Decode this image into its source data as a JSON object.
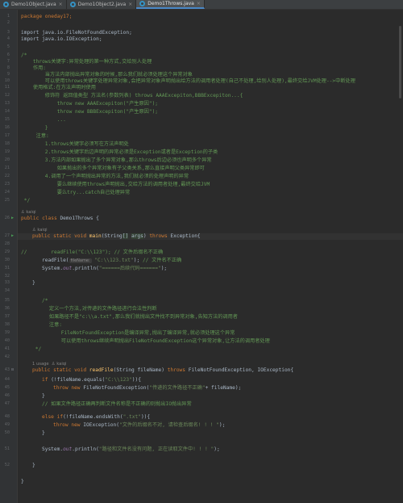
{
  "tabs": [
    {
      "label": "Demo1Object.java",
      "active": false
    },
    {
      "label": "Demo1Object2.java",
      "active": false
    },
    {
      "label": "Demo1Throws.java",
      "active": true
    }
  ],
  "gutter": {
    "numbers": [
      "1",
      "2",
      "3",
      "4",
      "5",
      "6",
      "7",
      "8",
      "9",
      "10",
      "11",
      "12",
      "13",
      "14",
      "15",
      "16",
      "17",
      "18",
      "19",
      "20",
      "21",
      "22",
      "23",
      "24",
      "25",
      "26",
      "27",
      "28",
      "29",
      "30",
      "31",
      "32",
      "33",
      "34",
      "35",
      "36",
      "37",
      "38",
      "39",
      "40",
      "41",
      "42",
      "43",
      "44",
      "45",
      "46",
      "47",
      "48",
      "49",
      "50",
      "51",
      "52"
    ],
    "run_icon": "run-icon"
  },
  "code": {
    "package_line": "package oneday17;",
    "import1": "import java.io.FileNotFoundException;",
    "import2": "import java.io.IOException;",
    "doc_open": "/*",
    "doc_l1": "    throws关键字:异常处理的第一种方式,交给别人处理",
    "doc_l2": "    作用:",
    "doc_l3": "        当方法内部抛出异常对象的时候,那么我们就必须处理这个异常对象",
    "doc_l4": "        可以使用throws关键字处理异常对象,会把异常对象声明抛出给方法的调用者处理(自己不处理,给别人处理),最终交给JVM处理-->中断处理",
    "doc_l5": "    使用格式:在方法声明时使用",
    "doc_l6": "        修饰符 返回值类型 方法名(参数列表) throws AAAExcepiton,BBBExcepiton...{",
    "doc_l7": "            throw new AAAExcepiton(\"产生原因\");",
    "doc_l8": "            throw new BBBExcepiton(\"产生原因\");",
    "doc_l9": "            ...",
    "doc_l10": "        }",
    "doc_l11": "     注意:",
    "doc_l12": "        1.throws关键字必须写在方法声明处",
    "doc_l13": "        2.throws关键字后边声明的异常必须是Exception或者是Exception的子类",
    "doc_l14": "        3.方法内部如果抛出了多个异常对象,那么throws后边必须也声明多个异常",
    "doc_l15": "            如果抛出的多个异常对象有子父类关系,那么直接声明父类异常即可",
    "doc_l16": "        4.调用了一个声明抛出异常的方法,我们就必须的处理声明的异常",
    "doc_l17": "            要么继续使用throws声明抛出,交给方法的调用者处理,最终交给JVM",
    "doc_l18": "            要么try...catch自己处理异常",
    "doc_close": " */",
    "author1": "kaiqi",
    "class_decl": "public class Demo1Throws {",
    "author2": "kaiqi",
    "main_decl_pre": "public static void main(String",
    "main_decl_arr": "[]",
    "main_decl_args": "args",
    "main_decl_post": ") throws Exception{",
    "l_comment_call": "//        readFile(\"C:\\\\123\"); // 文件后缀名不正确",
    "l_call_pre": "readFile(",
    "l_call_hint": "fileName:",
    "l_call_arg": "\"C:\\\\123.txt\"",
    "l_call_post": "); // 文件名不正确",
    "l_print1": "System.out.println(\"======后续代码======\");",
    "close_brace_main": "}",
    "doc2_open": "/*",
    "doc2_l1": "    定义一个方法,对传递的文件路径进行合法性判断",
    "doc2_l2": "    如果路径不是\"c:\\\\a.txt\",那么我们就抛出文件找不到异常对象,告知方法的调用者",
    "doc2_l3": "    注意:",
    "doc2_l4": "        FileNotFoundException是编译异常,抛出了编译异常,就必须处理这个异常",
    "doc2_l5": "        可以使用throws继续声明抛出FileNotFoundException这个异常对象,让方法的调用者处理",
    "doc2_close": " */",
    "usage": "1 usage",
    "author3": "kaiqi",
    "readfile_decl": "public static void readFile(String fileName) throws FileNotFoundException, IOException{",
    "if1": "if (!fileName.equals(\"C:\\\\123\")){",
    "throw1": "throw new FileNotFoundException(\"传递的文件路径不正确\"+ fileName);",
    "close1": "}",
    "comment_ext": "// 如果文件路径正确再判断文件名称是不正确的则抛出IO抛出异常",
    "elseif": "else if(!fileName.endsWith(\".txt\")){",
    "throw2": "throw new IOException(\"文件的后缀名不对, 请检查后缀名! ! ! \");",
    "close2": "}",
    "print2": "System.out.println(\"路径和文件名没有问题, 正在读取文件中! ! ! \");",
    "close_method": "}",
    "close_class": "}"
  },
  "colors": {
    "background": "#2b2b2b",
    "keyword": "#cc7832",
    "comment": "#629755",
    "string": "#6a8759",
    "method": "#ffc66d",
    "field": "#9876aa"
  }
}
